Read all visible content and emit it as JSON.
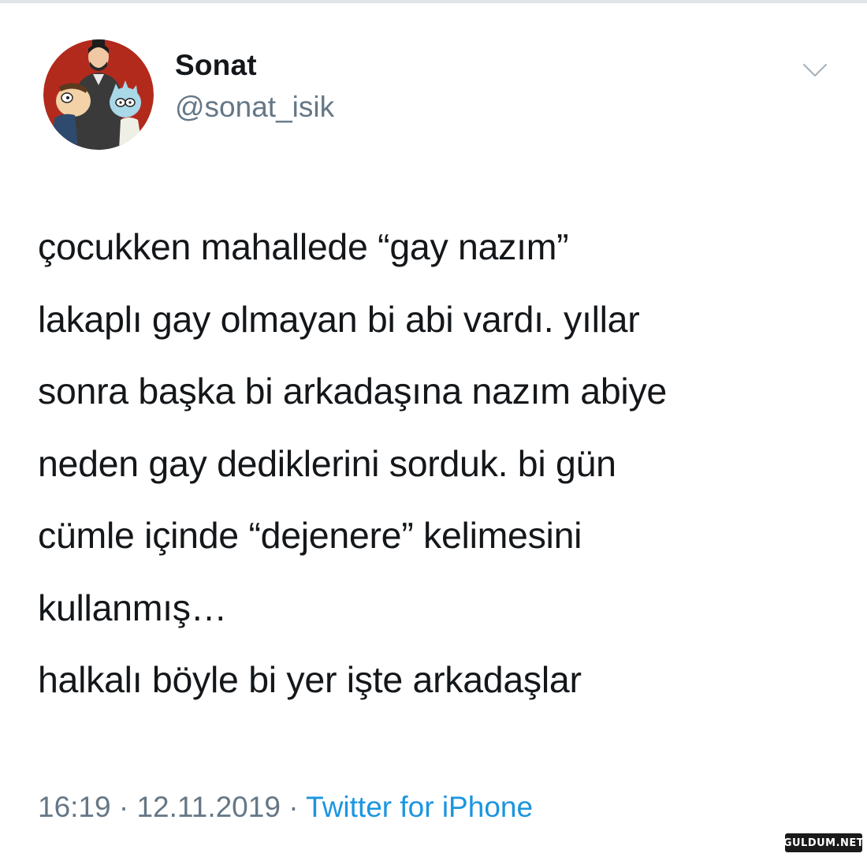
{
  "tweet": {
    "display_name": "Sonat",
    "handle": "@sonat_isik",
    "text_lines": [
      "çocukken mahallede “gay nazım”",
      "lakaplı gay olmayan bi abi vardı. yıllar",
      "sonra başka bi arkadaşına nazım abiye",
      "neden gay dediklerini sordu k. bi gün",
      "cümle içinde “dejenere” kelimesini",
      "kullanmış…",
      "halkalı böyle bi yer işte arkadaşlar"
    ],
    "time": "16:19",
    "date": "12.11.2019",
    "separator": " · ",
    "source": "Twitter for iPhone"
  },
  "icons": {
    "caret": "chevron-down-icon",
    "avatar": "cartoon-avatar"
  },
  "colors": {
    "name": "#14171a",
    "secondary": "#657786",
    "link": "#1b95e0",
    "avatar_bg": "#b22a1c"
  },
  "watermark": {
    "text": "GULDUM.NET"
  }
}
